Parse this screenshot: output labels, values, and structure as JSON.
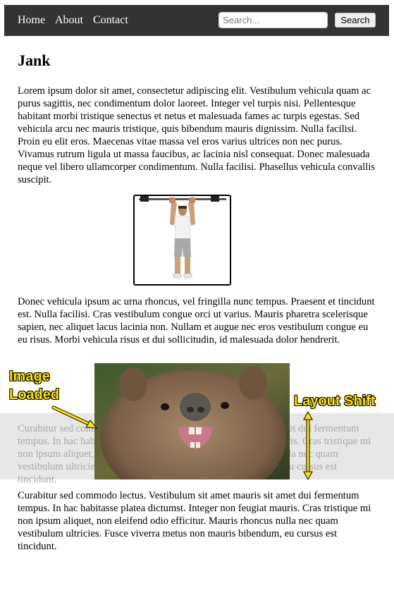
{
  "nav": {
    "links": [
      "Home",
      "About",
      "Contact"
    ],
    "search_placeholder": "Search...",
    "search_button": "Search",
    "background": "#333333"
  },
  "page": {
    "heading": "Jank",
    "para1": "Lorem ipsum dolor sit amet, consectetur adipiscing elit. Vestibulum vehicula quam ac purus sagittis, nec condimentum dolor laoreet. Integer vel turpis nisi. Pellentesque habitant morbi tristique senectus et netus et malesuada fames ac turpis egestas. Sed vehicula arcu nec mauris tristique, quis bibendum mauris dignissim. Nulla facilisi. Proin eu elit eros. Maecenas vitae massa vel eros varius ultrices non nec purus. Vivamus rutrum ligula ut massa faucibus, ac lacinia nisl consequat. Donec malesuada neque vel libero ullamcorper condimentum. Nulla facilisi. Phasellus vehicula convallis suscipit.",
    "para2": "Donec vehicula ipsum ac urna rhoncus, vel fringilla nunc tempus. Praesent et tincidunt est. Nulla facilisi. Cras vestibulum congue orci ut varius. Mauris pharetra scelerisque sapien, nec aliquet lacus lacinia non. Nullam et augue nec eros vestibulum congue eu eu risus. Morbi vehicula risus et dui sollicitudin, id malesuada dolor hendrerit.",
    "para3": "Curabitur sed commodo lectus. Vestibulum sit amet mauris sit amet dui fermentum tempus. In hac habitasse platea dictumst. Integer non feugiat mauris. Cras tristique mi non ipsum aliquet, non eleifend odio efficitur. Mauris rhoncus nulla nec quam vestibulum ultricies. Fusce viverra metus non mauris bibendum, eu cursus est tincidunt."
  },
  "annotations": {
    "image_loaded_line1": "Image",
    "image_loaded_line2": "Loaded",
    "layout_shift": "Layout Shift",
    "color": "#ffe600"
  },
  "images": {
    "figure1": "man-pullup-bar",
    "figure2": "wombat-closeup"
  }
}
